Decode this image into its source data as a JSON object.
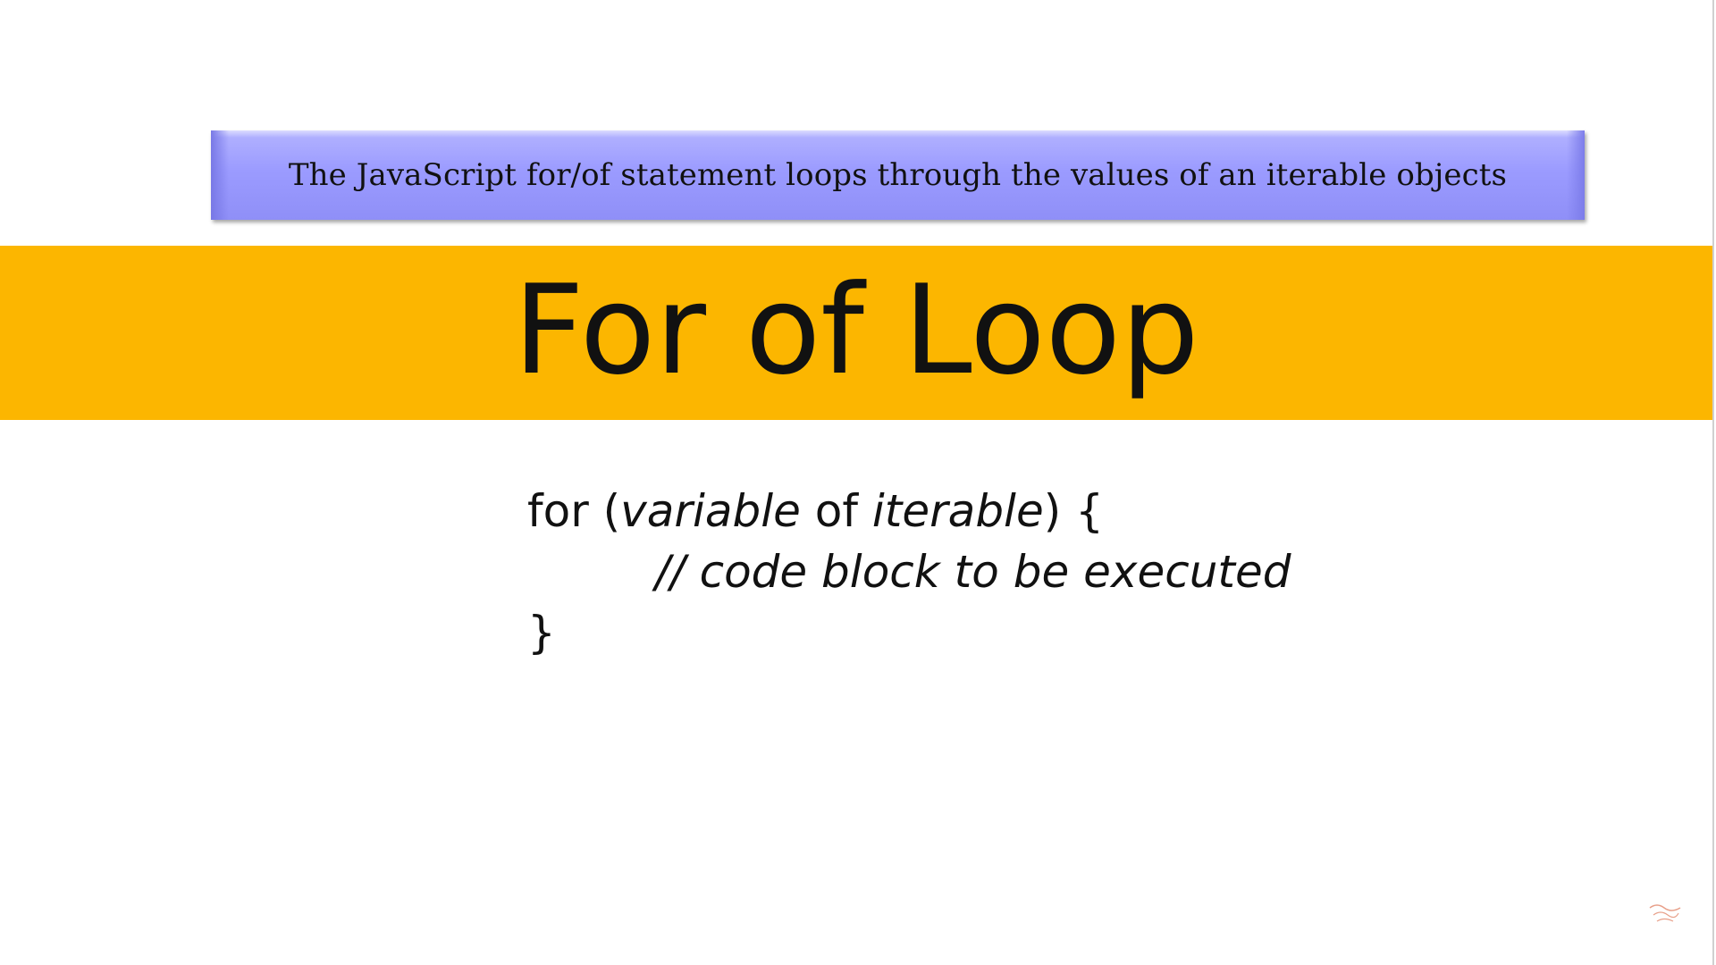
{
  "banner": {
    "text": "The JavaScript for/of statement loops through the values of an iterable objects",
    "color": "#9b9bff"
  },
  "title": {
    "text": "For of Loop",
    "band_color": "#fcb600"
  },
  "syntax": {
    "line1_prefix": "for (",
    "line1_var": "variable",
    "line1_of": " of ",
    "line1_iter": "iterable",
    "line1_suffix": ") {",
    "line2": "// code block to be executed",
    "line3": "}"
  },
  "watermark": {
    "icon": "channel-logo-icon"
  }
}
